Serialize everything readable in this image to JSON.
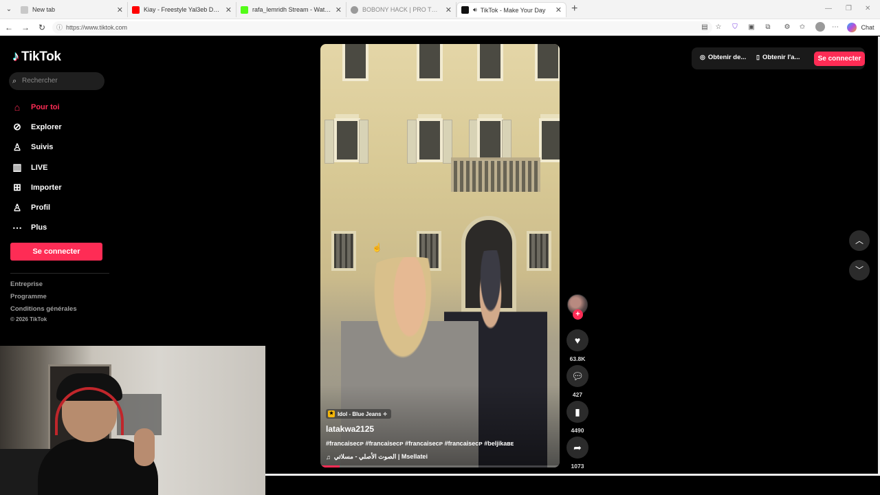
{
  "browser": {
    "tabs": [
      {
        "title": "New tab",
        "favicon_color": "#c8c8c8",
        "active": false
      },
      {
        "title": "Kiay - Freestyle Yal3eb Daddou (D",
        "favicon_color": "#ff0000",
        "active": false
      },
      {
        "title": "rafa_lemridh Stream - Watch Live o",
        "favicon_color": "#53fc18",
        "active": false
      },
      {
        "title": "BOBONY HACK | PRO TERMINAL",
        "favicon_color": "#9a9a9a",
        "active": false
      },
      {
        "title": "TikTok - Make Your Day",
        "favicon_color": "#111111",
        "active": true
      }
    ],
    "url": "https://www.tiktok.com",
    "copilot_label": "Chat"
  },
  "sidebar": {
    "logo": "TikTok",
    "search_placeholder": "Rechercher",
    "nav": [
      {
        "label": "Pour toi",
        "icon": "home-icon",
        "active": true
      },
      {
        "label": "Explorer",
        "icon": "compass-icon",
        "active": false
      },
      {
        "label": "Suivis",
        "icon": "following-icon",
        "active": false
      },
      {
        "label": "LIVE",
        "icon": "live-icon",
        "active": false
      },
      {
        "label": "Importer",
        "icon": "upload-icon",
        "active": false
      },
      {
        "label": "Profil",
        "icon": "profile-icon",
        "active": false
      },
      {
        "label": "Plus",
        "icon": "more-icon",
        "active": false
      }
    ],
    "login_label": "Se connecter",
    "footer_links": [
      "Entreprise",
      "Programme",
      "Conditions générales"
    ],
    "copyright": "© 2026 TikTok"
  },
  "header": {
    "get_coins_label": "Obtenir de...",
    "get_app_label": "Obtenir l'a...",
    "login_label": "Se connecter"
  },
  "video": {
    "tag": "Idol - Blue Jeans ✧",
    "author": "latakwa2125",
    "hashtags": "#francaiseᴄᴘ #francaiseᴄᴘ #francaiseᴄᴘ #francaiseᴄᴘ #beljikaʙᴇ",
    "sound": "الصوت الأصلي - مسلاتي | Msellatei",
    "progress": 0.08
  },
  "actions": {
    "likes": "63.8K",
    "comments": "427",
    "bookmarks": "4490",
    "shares": "1073"
  },
  "colors": {
    "accent": "#fe2c55",
    "background": "#000000",
    "sidebar_text": "#ffffff"
  }
}
